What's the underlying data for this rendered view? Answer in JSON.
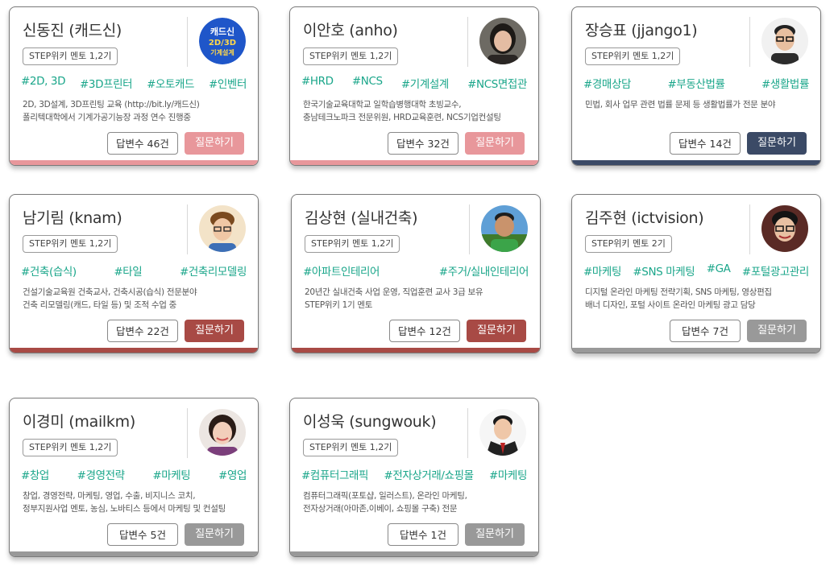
{
  "colors": {
    "pink": "#e8979b",
    "navy": "#3b4a66",
    "maroon": "#a84a45",
    "gray": "#999999",
    "tag_teal": "#1aa68a"
  },
  "mentors": [
    {
      "name": "신동진 (캐드신)",
      "badge": "STEP위키 멘토 1,2기",
      "tags": [
        "#2D, 3D",
        "#3D프린터",
        "#오토캐드",
        "#인벤터"
      ],
      "desc": [
        "2D, 3D설계, 3D프린팅 교육  (http://bit.ly/캐드신)",
        "폴리텍대학에서 기계가공기능장 과정 연수 진행중"
      ],
      "answers": "답변수 46건",
      "ask": "질문하기",
      "theme": "pink",
      "avatar_icon": "cad-logo-icon",
      "avatar_text": [
        "캐드신",
        "2D/3D",
        "기계설계"
      ]
    },
    {
      "name": "이안호 (anho)",
      "badge": "STEP위키 멘토 1,2기",
      "tags": [
        "#HRD",
        "#NCS",
        "#기계설계",
        "#NCS면접관"
      ],
      "desc": [
        "한국기술교육대학교 일학습병행대학 초빙교수,",
        "충남테크노파크 전문위원, HRD교육훈련, NCS기업컨설팅"
      ],
      "answers": "답변수 32건",
      "ask": "질문하기",
      "theme": "pink",
      "avatar_icon": "person-photo-icon"
    },
    {
      "name": "장승표 (jjango1)",
      "badge": "STEP위키 멘토 1,2기",
      "tags": [
        "#경매상담",
        "#부동산법률",
        "#생활법률"
      ],
      "desc": [
        "민법, 회사 업무 관련 법률 문제 등 생활법률가 전문 분야"
      ],
      "answers": "답변수 14건",
      "ask": "질문하기",
      "theme": "navy",
      "avatar_icon": "person-photo-icon"
    },
    {
      "name": "남기림 (knam)",
      "badge": "STEP위키 멘토 1,2기",
      "tags": [
        "#건축(습식)",
        "#타일",
        "#건축리모델링"
      ],
      "desc": [
        "건설기술교육원 건축교사, 건축시공(습식) 전문분야",
        "건축 리모델링(캐드, 타일 등) 및 조적 수업 중"
      ],
      "answers": "답변수 22건",
      "ask": "질문하기",
      "theme": "maroon",
      "avatar_icon": "person-photo-icon"
    },
    {
      "name": "김상현 (실내건축)",
      "badge": "STEP위키 멘토 1,2기",
      "tags": [
        "#아파트인테리어",
        "#주거/실내인테리어"
      ],
      "desc": [
        "20년간 실내건축 사업 운영, 직업훈련 교사 3급 보유",
        "STEP위키 1기 멘토"
      ],
      "answers": "답변수 12건",
      "ask": "질문하기",
      "theme": "maroon",
      "avatar_icon": "person-photo-icon"
    },
    {
      "name": "김주현 (ictvision)",
      "badge": "STEP위키 멘토 2기",
      "tags": [
        "#마케팅",
        "#SNS 마케팅",
        "#GA",
        "#포털광고관리"
      ],
      "desc": [
        "디지털 온라인 마케팅 전략기획, SNS  마케팅, 영상편집",
        "배너 디자인, 포털 사이트 온라인 마케팅 광고 담당"
      ],
      "answers": "답변수 7건",
      "ask": "질문하기",
      "theme": "gray",
      "avatar_icon": "person-photo-icon"
    },
    {
      "name": "이경미 (mailkm)",
      "badge": "STEP위키 멘토 1,2기",
      "tags": [
        "#창업",
        "#경영전략",
        "#마케팅",
        "#영업"
      ],
      "desc": [
        "창업, 경영전략, 마케팅, 영업, 수출, 비지니스 코치,",
        "정부지원사업 멘토, 농심, 노바티스 등에서 마케팅 및 컨설팅"
      ],
      "answers": "답변수 5건",
      "ask": "질문하기",
      "theme": "gray",
      "avatar_icon": "person-photo-icon"
    },
    {
      "name": "이성욱 (sungwouk)",
      "badge": "STEP위키 멘토 1,2기",
      "tags": [
        "#컴퓨터그래픽",
        "#전자상거래/쇼핑몰",
        "#마케팅"
      ],
      "desc": [
        "컴퓨터그래픽(포토샵, 일러스트), 온라인 마케팅,",
        "전자상거래(아마존,이베이, 쇼핑몰 구축) 전문"
      ],
      "answers": "답변수 1건",
      "ask": "질문하기",
      "theme": "gray",
      "avatar_icon": "person-photo-icon"
    }
  ]
}
